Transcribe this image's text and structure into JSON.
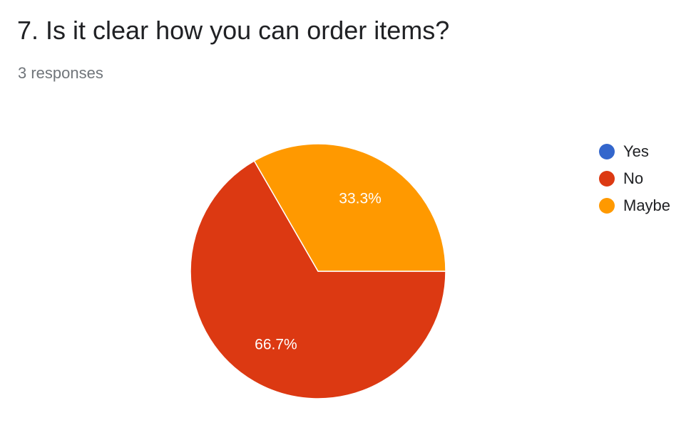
{
  "header": {
    "title": "7. Is it clear how you can order items?",
    "responses": "3 responses"
  },
  "chart_data": {
    "type": "pie",
    "categories": [
      "Yes",
      "No",
      "Maybe"
    ],
    "values": [
      0,
      2,
      1
    ],
    "percent_labels": [
      "",
      "66.7%",
      "33.3%"
    ],
    "colors": [
      "#3366cc",
      "#dc3912",
      "#ff9900"
    ],
    "legend_position": "right"
  }
}
